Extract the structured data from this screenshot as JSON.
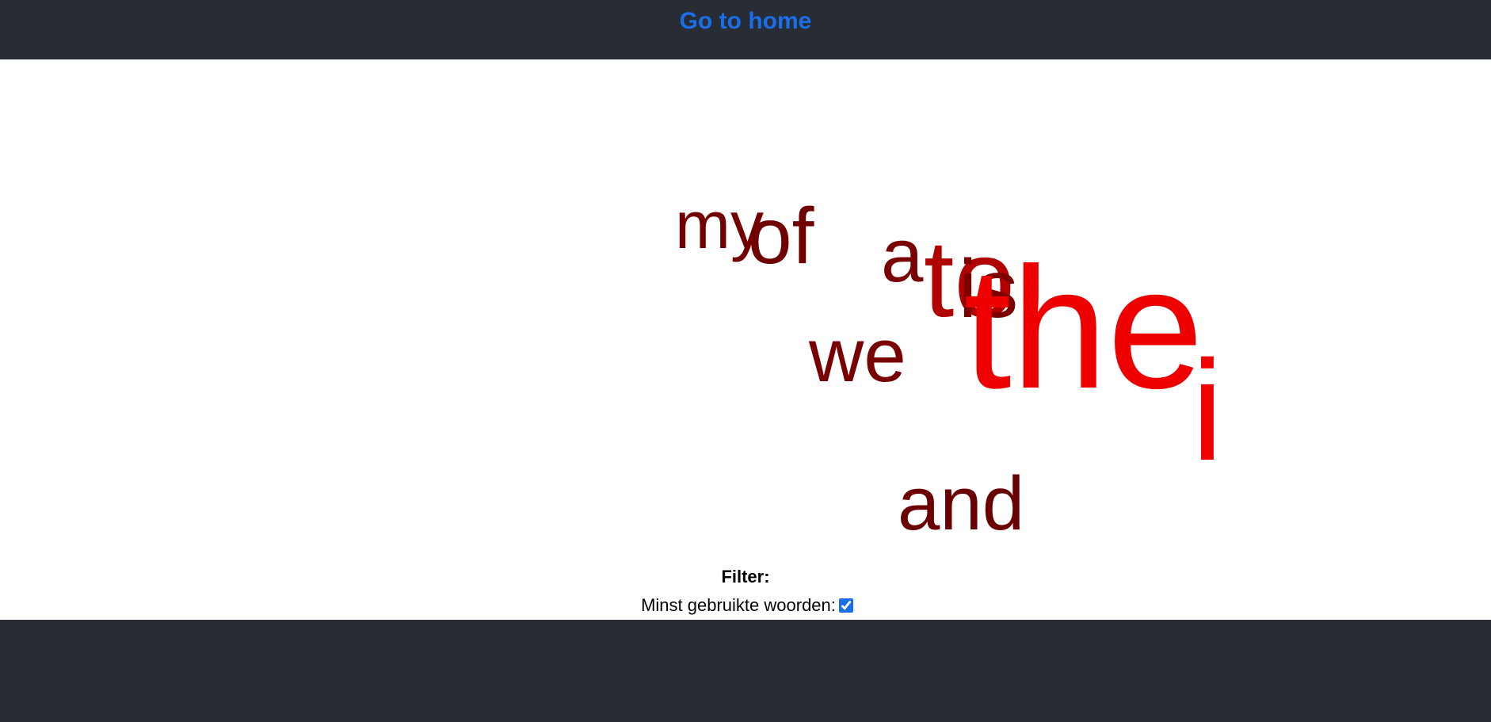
{
  "header": {
    "home_link": "Go to home"
  },
  "word_cloud": {
    "words": [
      {
        "text": "my",
        "color": "#730000"
      },
      {
        "text": "of",
        "color": "#700000"
      },
      {
        "text": "a",
        "color": "#7a0000"
      },
      {
        "text": "to",
        "color": "#b00000"
      },
      {
        "text": "is",
        "color": "#7d0000"
      },
      {
        "text": "we",
        "color": "#780000"
      },
      {
        "text": "the",
        "color": "#ee0000"
      },
      {
        "text": "i",
        "color": "#f00000"
      },
      {
        "text": "and",
        "color": "#6a0000"
      }
    ]
  },
  "filter": {
    "title": "Filter:",
    "least_used_label": "Minst gebruikte woorden:",
    "least_used_checked": true
  },
  "colors": {
    "bar_background": "#282c34",
    "link": "#1a6fe8"
  }
}
